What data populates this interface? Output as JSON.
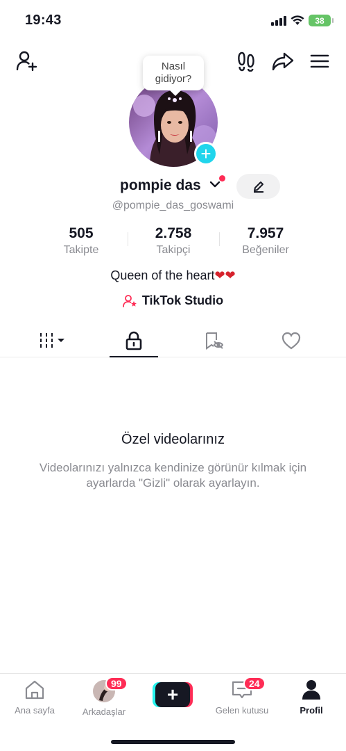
{
  "status_bar": {
    "time": "19:43",
    "battery": "38"
  },
  "tooltip": {
    "line1": "Nasıl",
    "line2": "gidiyor?"
  },
  "profile": {
    "name": "pompie das",
    "handle": "@pompie_das_goswami",
    "bio_text": "Queen of the heart",
    "bio_emoji": "❤❤",
    "studio_label": "TikTok Studio"
  },
  "stats": [
    {
      "value": "505",
      "label": "Takipte"
    },
    {
      "value": "2.758",
      "label": "Takipçi"
    },
    {
      "value": "7.957",
      "label": "Beğeniler"
    }
  ],
  "tabs": [
    {
      "icon": "grid-filter-icon",
      "active": false
    },
    {
      "icon": "lock-icon",
      "active": true
    },
    {
      "icon": "bookmark-hidden-icon",
      "active": false
    },
    {
      "icon": "heart-outline-icon",
      "active": false
    }
  ],
  "empty_state": {
    "title": "Özel videolarınız",
    "description": "Videolarınızı yalnızca kendinize görünür kılmak için ayarlarda \"Gizli\" olarak ayarlayın."
  },
  "bottom_nav": {
    "home": "Ana sayfa",
    "friends": "Arkadaşlar",
    "friends_badge": "99",
    "inbox": "Gelen kutusu",
    "inbox_badge": "24",
    "profile": "Profil",
    "create": "+"
  },
  "colors": {
    "accent": "#fe2c55",
    "cyan": "#25f4ee",
    "text": "#161823",
    "muted": "#8a8b91"
  }
}
